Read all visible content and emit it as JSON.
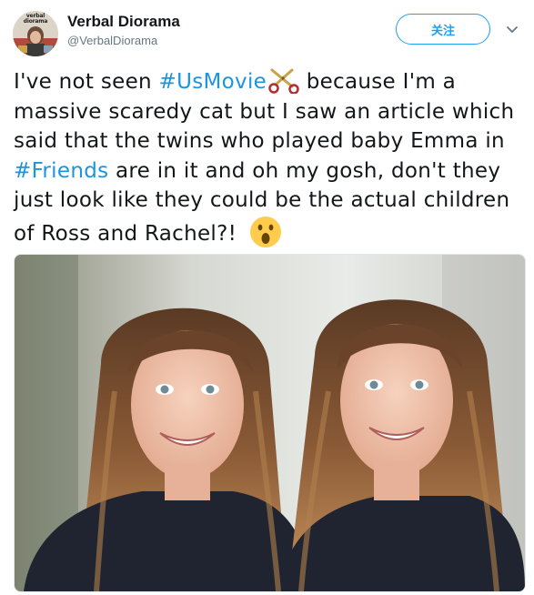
{
  "author": {
    "display_name": "Verbal Diorama",
    "handle": "@VerbalDiorama",
    "avatar_text_line1": "verbal",
    "avatar_text_line2": "diorama"
  },
  "follow_button": {
    "label": "关注"
  },
  "icons": {
    "caret": "chevron-down-icon",
    "scissors": "scissors-emoji",
    "surprised": "hushed-face-emoji"
  },
  "tweet": {
    "t1": "I've not seen ",
    "hashtag1": "#UsMovie",
    "t2": " because I'm a",
    "t3": "massive scaredy cat but I saw an article which",
    "t4": "said that the twins who played baby Emma in",
    "hashtag2": "#Friends",
    "t5": " are in it and oh my gosh, don't they",
    "t6": "just look like they could be the actual children",
    "t7": "of Ross and Rachel?! "
  },
  "colors": {
    "link_blue": "#1b95e0",
    "follow_blue": "#1da1f2",
    "text": "#14171a",
    "secondary": "#657786"
  }
}
